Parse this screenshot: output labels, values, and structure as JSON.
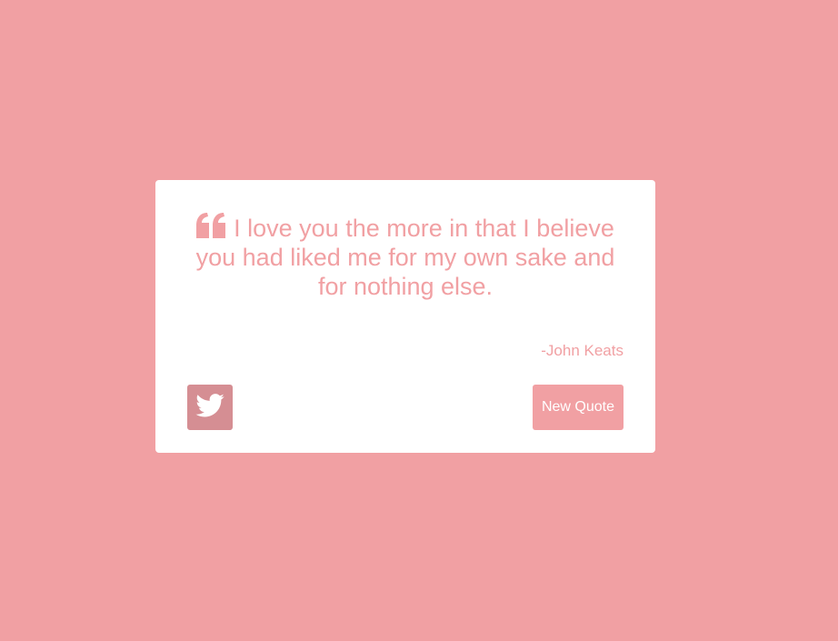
{
  "theme": {
    "background": "#f1a0a3",
    "card": "#ffffff",
    "accent": "#f1a0a3",
    "tweet_button": "#d58e93",
    "button_text": "#ffffff"
  },
  "quote": {
    "icon": "quote-left-icon",
    "text": "I love you the more in that I believe you had liked me for my own sake and for nothing else.",
    "author": "-John Keats"
  },
  "actions": {
    "tweet_icon": "twitter-icon",
    "new_quote_label": "New Quote"
  }
}
